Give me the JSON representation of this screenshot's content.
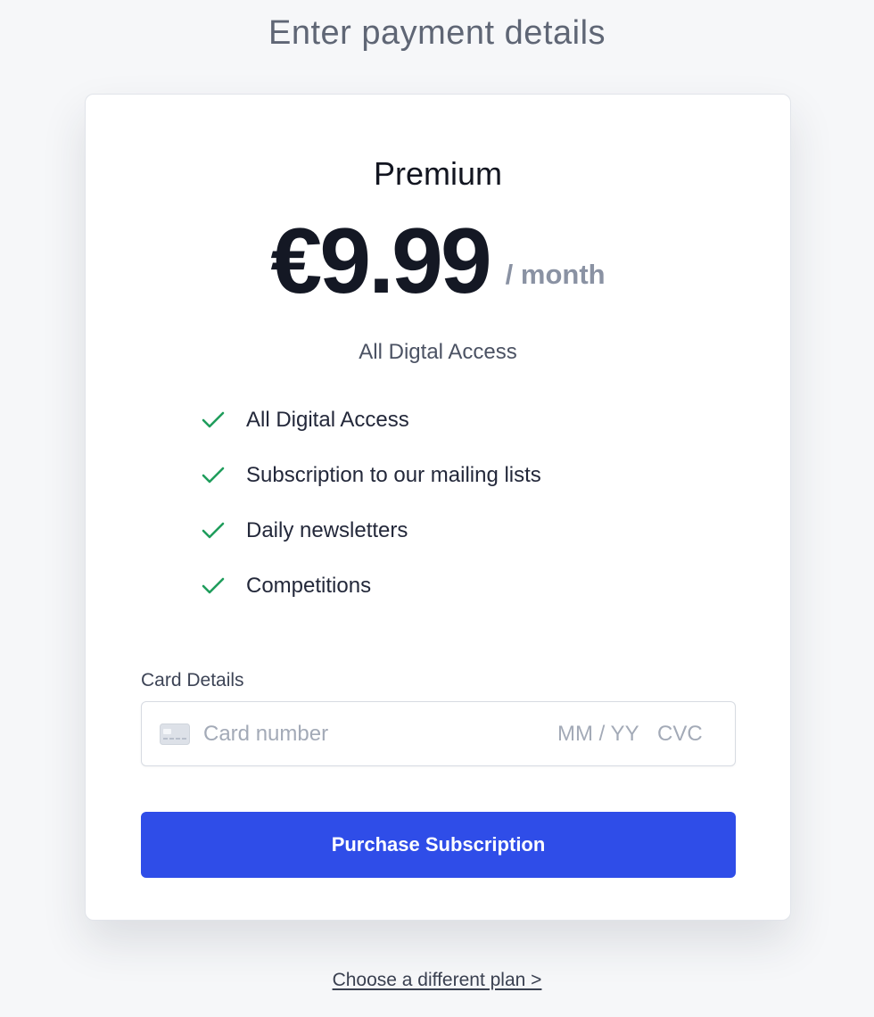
{
  "page": {
    "title": "Enter payment details"
  },
  "plan": {
    "name": "Premium",
    "price": "€9.99",
    "period": "/ month",
    "subtitle": "All Digtal Access",
    "features": [
      {
        "text": "All Digital Access",
        "icon": "check-icon"
      },
      {
        "text": "Subscription to our mailing lists",
        "icon": "check-icon"
      },
      {
        "text": "Daily newsletters",
        "icon": "check-icon"
      },
      {
        "text": "Competitions",
        "icon": "check-icon"
      }
    ]
  },
  "payment": {
    "label": "Card Details",
    "card_icon": "credit-card-icon",
    "card_number_placeholder": "Card number",
    "expiry_placeholder": "MM / YY",
    "cvc_placeholder": "CVC",
    "submit_label": "Purchase Subscription"
  },
  "footer": {
    "link_label": "Choose a different plan >"
  },
  "colors": {
    "accent": "#2f4de8",
    "check": "#1f9d5c",
    "background": "#f6f7f9"
  }
}
